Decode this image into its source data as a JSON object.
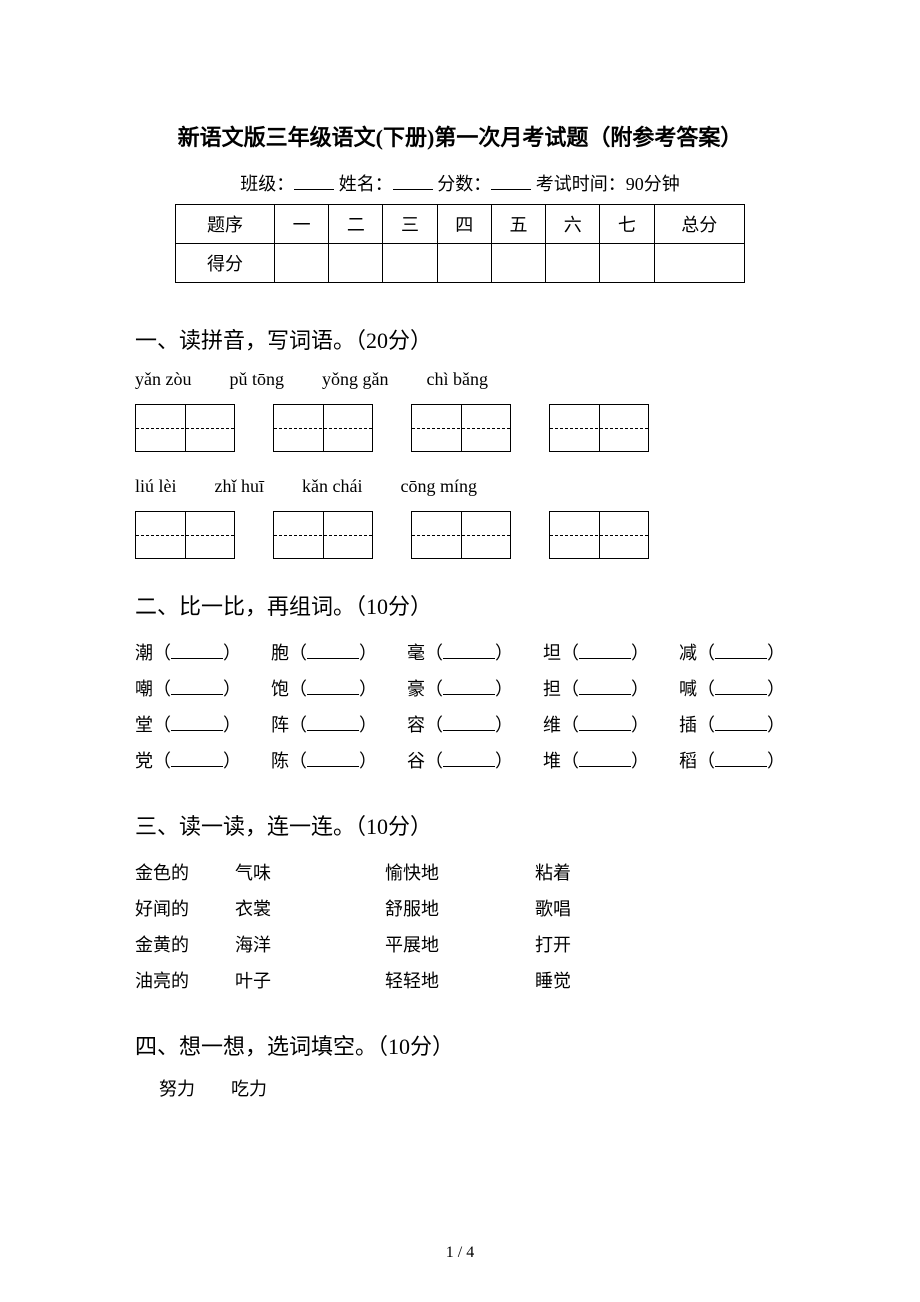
{
  "title": "新语文版三年级语文(下册)第一次月考试题（附参考答案）",
  "info": {
    "class_label": "班级：",
    "name_label": "姓名：",
    "score_label": "分数：",
    "time_label": "考试时间：90分钟"
  },
  "score_table": {
    "row1_label": "题序",
    "row2_label": "得分",
    "cols": [
      "一",
      "二",
      "三",
      "四",
      "五",
      "六",
      "七",
      "总分"
    ]
  },
  "sec1": {
    "title": "一、读拼音，写词语。（20分）",
    "row1": [
      "yǎn zòu",
      "pǔ tōng",
      "yǒng gǎn",
      "chì bǎng"
    ],
    "row2": [
      "liú lèi",
      "zhǐ huī",
      "kǎn chái",
      "cōng míng"
    ]
  },
  "sec2": {
    "title": "二、比一比，再组词。（10分）",
    "rows": [
      [
        "潮",
        "胞",
        "毫",
        "坦",
        "减"
      ],
      [
        "嘲",
        "饱",
        "豪",
        "担",
        "喊"
      ],
      [
        "堂",
        "阵",
        "容",
        "维",
        "插"
      ],
      [
        "党",
        "陈",
        "谷",
        "堆",
        "稻"
      ]
    ]
  },
  "sec3": {
    "title": "三、读一读，连一连。（10分）",
    "rows": [
      [
        "金色的",
        "气味",
        "愉快地",
        "粘着"
      ],
      [
        "好闻的",
        "衣裳",
        "舒服地",
        "歌唱"
      ],
      [
        "金黄的",
        "海洋",
        "平展地",
        "打开"
      ],
      [
        "油亮的",
        "叶子",
        "轻轻地",
        "睡觉"
      ]
    ]
  },
  "sec4": {
    "title": "四、想一想，选词填空。（10分）",
    "words": "努力　　吃力"
  },
  "footer": "1 / 4"
}
